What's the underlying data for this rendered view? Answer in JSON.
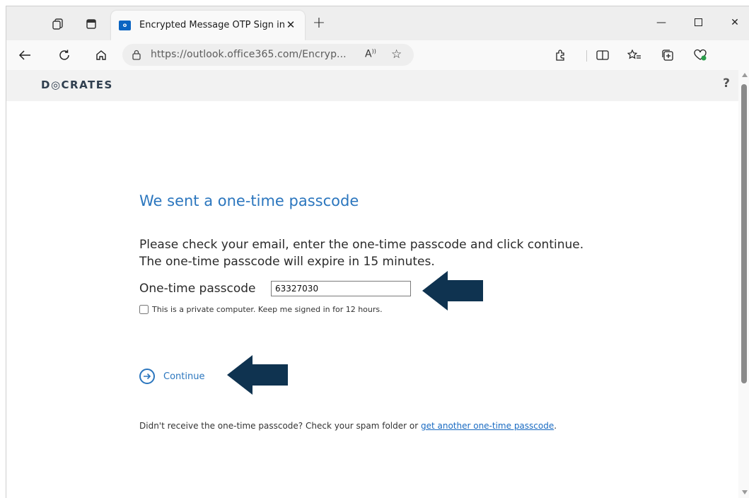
{
  "browser": {
    "tab": {
      "title": "Encrypted Message OTP Sign in",
      "favicon_text": "o"
    },
    "address": {
      "url_host": "https://outlook.office365.com",
      "url_path": "/Encryp..."
    },
    "icons": [
      "workspaces-icon",
      "tab-actions-icon",
      "back-icon",
      "refresh-icon",
      "home-icon",
      "lock-icon",
      "read-aloud-icon",
      "favorite-icon",
      "extensions-icon",
      "split-screen-icon",
      "favorites-icon",
      "collections-icon",
      "browser-essentials-icon"
    ]
  },
  "page": {
    "brand": "D◎CRATES",
    "help": "?",
    "heading": "We sent a one-time passcode",
    "instruction_line1": "Please check your email, enter the one-time passcode and click continue.",
    "instruction_line2": "The one-time passcode will expire in 15 minutes.",
    "otp_label": "One-time passcode",
    "otp_value": "63327030",
    "keep_signed_in": "This is a private computer. Keep me signed in for 12 hours.",
    "continue": "Continue",
    "resend_prefix": "Didn't receive the one-time passcode? Check your spam folder or ",
    "resend_link": "get another one-time passcode",
    "resend_suffix": "."
  },
  "colors": {
    "accent": "#2b76be",
    "arrow": "#0f3350"
  }
}
